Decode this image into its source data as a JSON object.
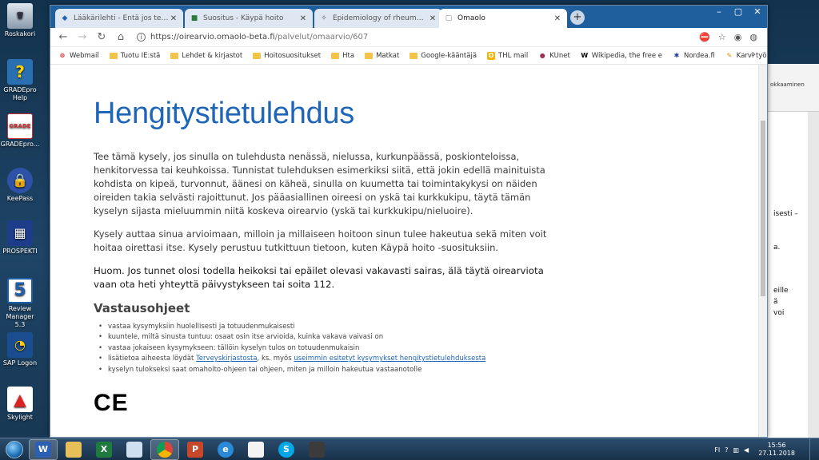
{
  "desktop": {
    "icons": [
      {
        "label": "Roskakori",
        "icon": "recycle-bin-icon"
      },
      {
        "label": "GRADEpro Help",
        "icon": "help-icon"
      },
      {
        "label": "GRADEpro...",
        "icon": "gradepro-icon"
      },
      {
        "label": "KeePass",
        "icon": "keepass-lock-icon"
      },
      {
        "label": "PROSPEKTI",
        "icon": "prospekti-icon"
      },
      {
        "label": "Review Manager 5.3",
        "icon": "review-manager-icon"
      },
      {
        "label": "SAP Logon",
        "icon": "sap-logon-icon"
      },
      {
        "label": "Skylight",
        "icon": "skylight-icon"
      }
    ]
  },
  "background_doc": {
    "ribbon_label": "okkaaminen",
    "snippets": [
      "isesti –",
      "a.",
      "eille",
      "ä",
      "voi"
    ]
  },
  "browser": {
    "tabs": [
      {
        "title": "Lääkärilehti - Entä jos terveyskeskus",
        "active": false
      },
      {
        "title": "Suositus - Käypä hoito",
        "active": false
      },
      {
        "title": "Epidemiology of rheumatoid arthritis",
        "active": false
      },
      {
        "title": "Omaolo",
        "active": true
      }
    ],
    "new_tab_symbol": "+",
    "url_host": "https://oirearvio.omaolo-beta.fi",
    "url_path": "/palvelut/omaarvio/607",
    "bookmarks": [
      {
        "label": "Webmail"
      },
      {
        "label": "Tuotu IE:stä"
      },
      {
        "label": "Lehdet & kirjastot"
      },
      {
        "label": "Hoitosuositukset"
      },
      {
        "label": "Hta"
      },
      {
        "label": "Matkat"
      },
      {
        "label": "Google-kääntäjä"
      },
      {
        "label": "THL mail"
      },
      {
        "label": "KUnet"
      },
      {
        "label": "Wikipedia, the free e"
      },
      {
        "label": "Nordea.fi"
      },
      {
        "label": "Karvi työtila"
      }
    ],
    "bookmarks_more": "»"
  },
  "page": {
    "title": "Hengitystietulehdus",
    "intro": "Tee tämä kysely, jos sinulla on tulehdusta nenässä, nielussa, kurkunpäässä, poskionteloissa, henkitorvessa tai keuhkoissa. Tunnistat tulehduksen esimerkiksi siitä, että jokin edellä mainituista kohdista on kipeä, turvonnut, äänesi on käheä, sinulla on kuumetta tai toimintakykysi on näiden oireiden takia selvästi rajoittunut. Jos pääasiallinen oireesi on yskä tai kurkkukipu, täytä tämän kyselyn sijasta mieluummin niitä koskeva oirearvio (yskä tai kurkkukipu/nieluoire).",
    "purpose": "Kysely auttaa sinua arvioimaan, milloin ja millaiseen hoitoon sinun tulee hakeutua sekä miten voit hoitaa oirettasi itse. Kysely perustuu tutkittuun tietoon, kuten Käypä hoito -suosituksiin.",
    "warning": "Huom. Jos tunnet olosi todella heikoksi tai epäilet olevasi vakavasti sairas, älä täytä oirearviota vaan ota heti yhteyttä päivystykseen tai soita 112.",
    "instructions_heading": "Vastausohjeet",
    "instructions": [
      "vastaa kysymyksiin huolellisesti ja totuudenmukaisesti",
      "kuuntele, miltä sinusta tuntuu: osaat osin itse arvioida, kuinka vakava vaivasi on",
      "vastaa jokaiseen kysymykseen: tällöin kyselyn tulos on totuudenmukaisin"
    ],
    "info_prefix": "lisätietoa aiheesta löydät ",
    "info_link1": "Terveyskirjastosta",
    "info_middle": ", ks. myös ",
    "info_link2": "useimmin esitetyt kysymykset hengitystietulehduksesta",
    "result_note": "kyselyn tulokseksi saat omahoito-ohjeen tai ohjeen, miten ja milloin hakeutua vastaanotolle",
    "ce_mark": "CE"
  },
  "taskbar": {
    "apps": [
      {
        "name": "word",
        "icon": "word-icon",
        "glyph": "W"
      },
      {
        "name": "explorer",
        "icon": "folder-icon",
        "glyph": ""
      },
      {
        "name": "excel",
        "icon": "excel-icon",
        "glyph": "X"
      },
      {
        "name": "notepad",
        "icon": "notepad-icon",
        "glyph": ""
      },
      {
        "name": "chrome",
        "icon": "chrome-icon",
        "glyph": ""
      },
      {
        "name": "powerpoint",
        "icon": "powerpoint-icon",
        "glyph": "P"
      },
      {
        "name": "ie",
        "icon": "internet-explorer-icon",
        "glyph": "e"
      },
      {
        "name": "blank-doc",
        "icon": "document-icon",
        "glyph": ""
      },
      {
        "name": "skype",
        "icon": "skype-icon",
        "glyph": "S"
      },
      {
        "name": "media",
        "icon": "media-icon",
        "glyph": ""
      }
    ],
    "language": "FI",
    "time": "15:56",
    "date": "27.11.2018"
  },
  "colors": {
    "title_blue": "#1f66b8",
    "tabstrip": "#1f5f9e"
  }
}
